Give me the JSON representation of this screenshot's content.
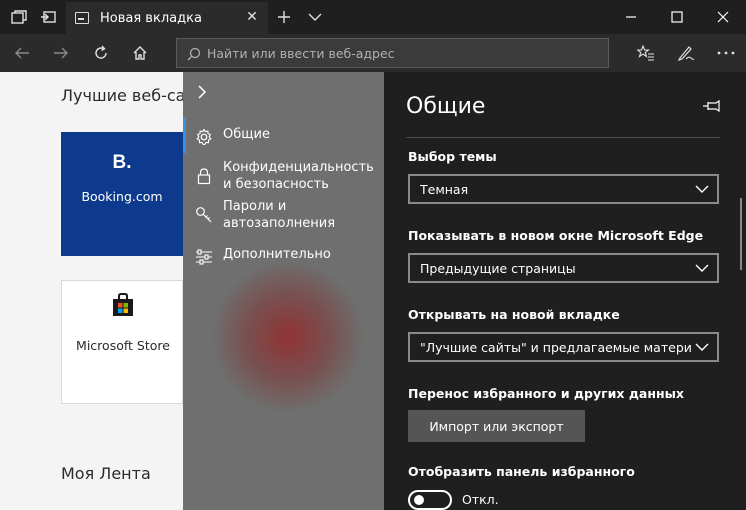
{
  "titlebar": {
    "tab_title": "Новая вкладка",
    "icons": [
      "tab-manager-icon",
      "tabs-aside-icon",
      "tab-favicon-icon",
      "close-tab-icon",
      "new-tab-icon",
      "tab-preview-icon",
      "minimize-icon",
      "maximize-icon",
      "close-window-icon"
    ]
  },
  "navbar": {
    "address_placeholder": "Найти или ввести веб-адрес",
    "icons": [
      "back-icon",
      "forward-icon",
      "refresh-icon",
      "home-icon",
      "search-icon",
      "favorites-icon",
      "notes-icon",
      "more-icon"
    ]
  },
  "page": {
    "top_sites_heading": "Лучшие веб-са",
    "tiles": [
      {
        "label": "Booking.com",
        "logo": "B.",
        "color": "#0d3a8c"
      },
      {
        "label": "Microsoft Store",
        "logo": "store-bag-icon"
      }
    ],
    "feed_heading": "Моя Лента"
  },
  "settings_nav": {
    "items": [
      {
        "label": "Общие",
        "icon": "gear-icon",
        "active": true
      },
      {
        "label": "Конфиденциальность и безопасность",
        "icon": "lock-icon"
      },
      {
        "label": "Пароли и автозаполнения",
        "icon": "key-icon"
      },
      {
        "label": "Дополнительно",
        "icon": "sliders-icon"
      }
    ]
  },
  "settings": {
    "title": "Общие",
    "theme_label": "Выбор темы",
    "theme_value": "Темная",
    "new_window_label": "Показывать в новом окне Microsoft Edge",
    "new_window_value": "Предыдущие страницы",
    "new_tab_label": "Открывать на новой вкладке",
    "new_tab_value": "\"Лучшие сайты\" и предлагаемые материалы",
    "transfer_label": "Перенос избранного и других данных",
    "import_button": "Импорт или экспорт",
    "favorites_bar_label": "Отобразить панель избранного",
    "favorites_bar_state": "Откл."
  },
  "colors": {
    "accent": "#3a8ee6",
    "panel_bg": "#1f1f1f",
    "nav_bg": "#6f6f6f",
    "booking_blue": "#0d3a8c"
  }
}
